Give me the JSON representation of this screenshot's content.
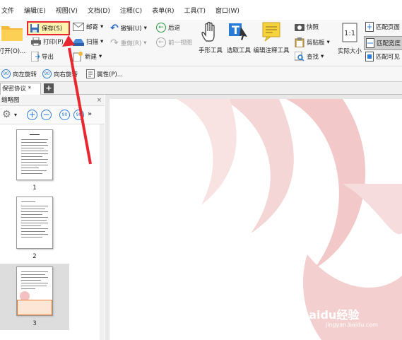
{
  "menu": [
    "文件",
    "编辑(E)",
    "视图(V)",
    "文档(D)",
    "注释(C)",
    "表单(R)",
    "工具(T)",
    "窗口(W)"
  ],
  "ribbon": {
    "open": "打开(O)...",
    "save": "保存(S)",
    "print": "打印(P)...",
    "export": "导出",
    "email": "邮寄",
    "scan": "扫描",
    "new": "新建",
    "undo": "撤销(U)",
    "redo": "重做(R)",
    "back": "后退",
    "prev_view": "前一视图",
    "hand_tool": "手形工具",
    "select_tool": "选取工具",
    "edit_annot_tool": "编辑注释工具",
    "snapshot": "快照",
    "clipboard": "剪贴板",
    "find": "查找",
    "actual_size": "实际大小",
    "fit_page": "匹配页面",
    "fit_width": "匹配宽度",
    "fit_visible": "匹配可见"
  },
  "toolbar2": {
    "rotate_left": "向左旋转",
    "rotate_right": "向右旋转",
    "properties": "属性(P)..."
  },
  "tab": {
    "name": "保密协议 *",
    "add": "+"
  },
  "panel": {
    "title": "缩略图",
    "close": "×"
  },
  "thumbnails": [
    {
      "num": "1"
    },
    {
      "num": "2"
    },
    {
      "num": "3"
    }
  ],
  "watermark": "Baidu经验",
  "watermark_url": "jingyan.baidu.com",
  "colors": {
    "highlight": "#e8272f",
    "arrow": "#e8272f",
    "selected_bg": "#ddd"
  }
}
